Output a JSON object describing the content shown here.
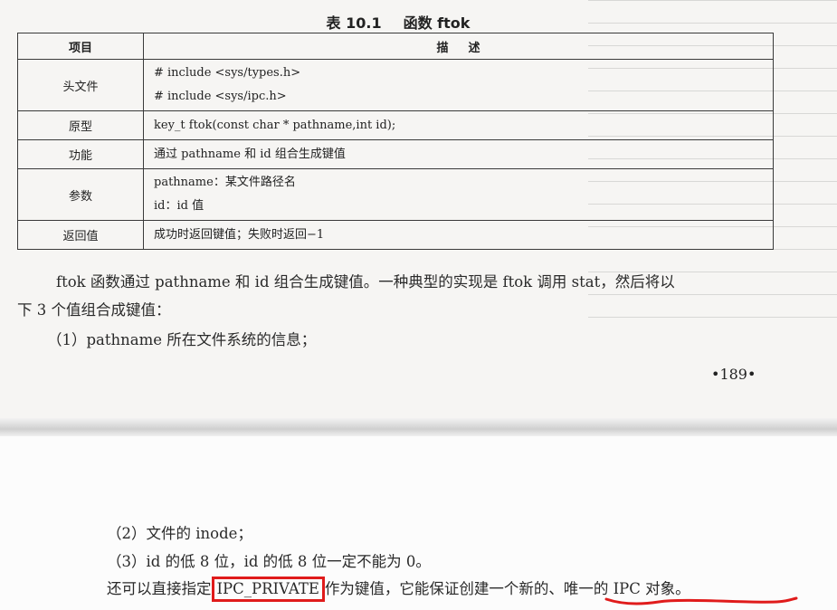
{
  "top_page": {
    "caption_number": "表 10.1",
    "caption_title": "函数 ftok",
    "table": {
      "header_item": "项目",
      "header_desc": "描述",
      "rows": [
        {
          "key": "头文件",
          "lines": [
            "# include <sys/types.h>",
            "# include <sys/ipc.h>"
          ]
        },
        {
          "key": "原型",
          "lines": [
            "key_t ftok(const char * pathname,int id);"
          ]
        },
        {
          "key": "功能",
          "lines": [
            "通过 pathname 和 id 组合生成键值"
          ]
        },
        {
          "key": "参数",
          "lines": [
            "pathname：某文件路径名",
            "id：id 值"
          ]
        },
        {
          "key": "返回值",
          "lines": [
            "成功时返回键值；失败时返回−1"
          ]
        }
      ]
    },
    "para1_line1": "ftok 函数通过 pathname 和 id 组合生成键值。一种典型的实现是 ftok 调用 stat，然后将以",
    "para1_line2": "下 3 个值组合成键值：",
    "item1": "（1）pathname 所在文件系统的信息；",
    "page_number": "•189•"
  },
  "bottom_page": {
    "item2": "（2）文件的 inode；",
    "item3": "（3）id 的低 8 位，id 的低 8 位一定不能为 0。",
    "sentence_prefix": "还可以直接指定",
    "highlighted_term": "IPC_PRIVATE",
    "sentence_suffix": "作为键值，它能保证创建一个新的、唯一的 IPC 对象。"
  },
  "colors": {
    "annotation_red": "#e01b1b"
  }
}
